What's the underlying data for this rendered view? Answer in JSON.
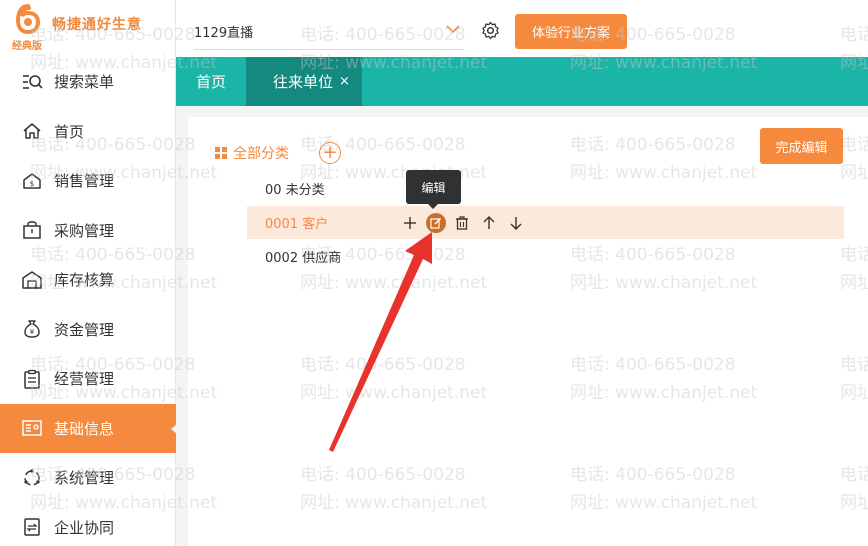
{
  "brand": {
    "name": "畅捷通好生意",
    "edition": "经典版",
    "color": "#f58a3f"
  },
  "sidebar": {
    "items": [
      {
        "label": "搜索菜单",
        "icon": "search-menu-icon",
        "active": false
      },
      {
        "label": "首页",
        "icon": "home-icon",
        "active": false
      },
      {
        "label": "销售管理",
        "icon": "sales-icon",
        "active": false
      },
      {
        "label": "采购管理",
        "icon": "purchase-icon",
        "active": false
      },
      {
        "label": "库存核算",
        "icon": "warehouse-icon",
        "active": false
      },
      {
        "label": "资金管理",
        "icon": "money-bag-icon",
        "active": false
      },
      {
        "label": "经营管理",
        "icon": "clipboard-icon",
        "active": false
      },
      {
        "label": "基础信息",
        "icon": "id-card-icon",
        "active": true
      },
      {
        "label": "系统管理",
        "icon": "system-icon",
        "active": false
      },
      {
        "label": "企业协同",
        "icon": "collab-icon",
        "active": false
      }
    ]
  },
  "header": {
    "store_value": "1129直播",
    "experience_button": "体验行业方案"
  },
  "tabs": [
    {
      "label": "首页",
      "active": false
    },
    {
      "label": "往来单位",
      "active": true,
      "close": "×"
    }
  ],
  "category": {
    "all_label": "全部分类",
    "add_symbol": "+",
    "finish_button": "完成编辑",
    "rows": [
      {
        "label": "00 未分类"
      },
      {
        "label": "0001 客户"
      },
      {
        "label": "0002 供应商"
      }
    ],
    "row_actions": {
      "add": "+"
    },
    "tooltip": "编辑"
  },
  "watermark": {
    "phone": "电话: 400-665-0028",
    "site": "网址: www.chanjet.net"
  },
  "colors": {
    "accent": "#f58a3f",
    "teal": "#1bb5a7",
    "teal_dark": "#14897f",
    "highlight_row": "#fde8dc",
    "annotation_arrow": "#e8322c"
  }
}
